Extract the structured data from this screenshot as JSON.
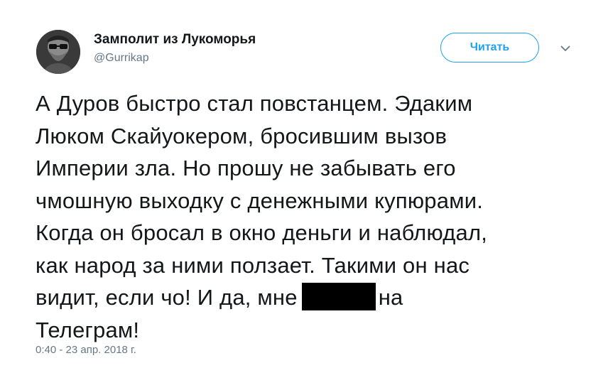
{
  "author": {
    "display_name": "Замполит из Лукоморья",
    "handle": "@Gurrikap"
  },
  "actions": {
    "follow_label": "Читать",
    "more_icon": "chevron-down-icon"
  },
  "tweet": {
    "lines": [
      "А Дуров быстро стал повстанцем. Эдаким",
      "Люком Скайуокером, бросившим вызов",
      "Империи зла. Но прошу не забывать его",
      "чмошную выходку с денежными купюрами.",
      "Когда он бросал в окно деньги и наблюдал,",
      "как народ за ними ползает. Такими он нас"
    ],
    "line7_before_redaction": "видит, если чо! И да, мне",
    "line7_after_redaction": "на",
    "last_line": "Телеграм!"
  },
  "meta": {
    "timestamp": "0:40 - 23 апр. 2018 г."
  },
  "colors": {
    "accent": "#1da1f2",
    "text": "#14171a",
    "secondary": "#657786"
  }
}
